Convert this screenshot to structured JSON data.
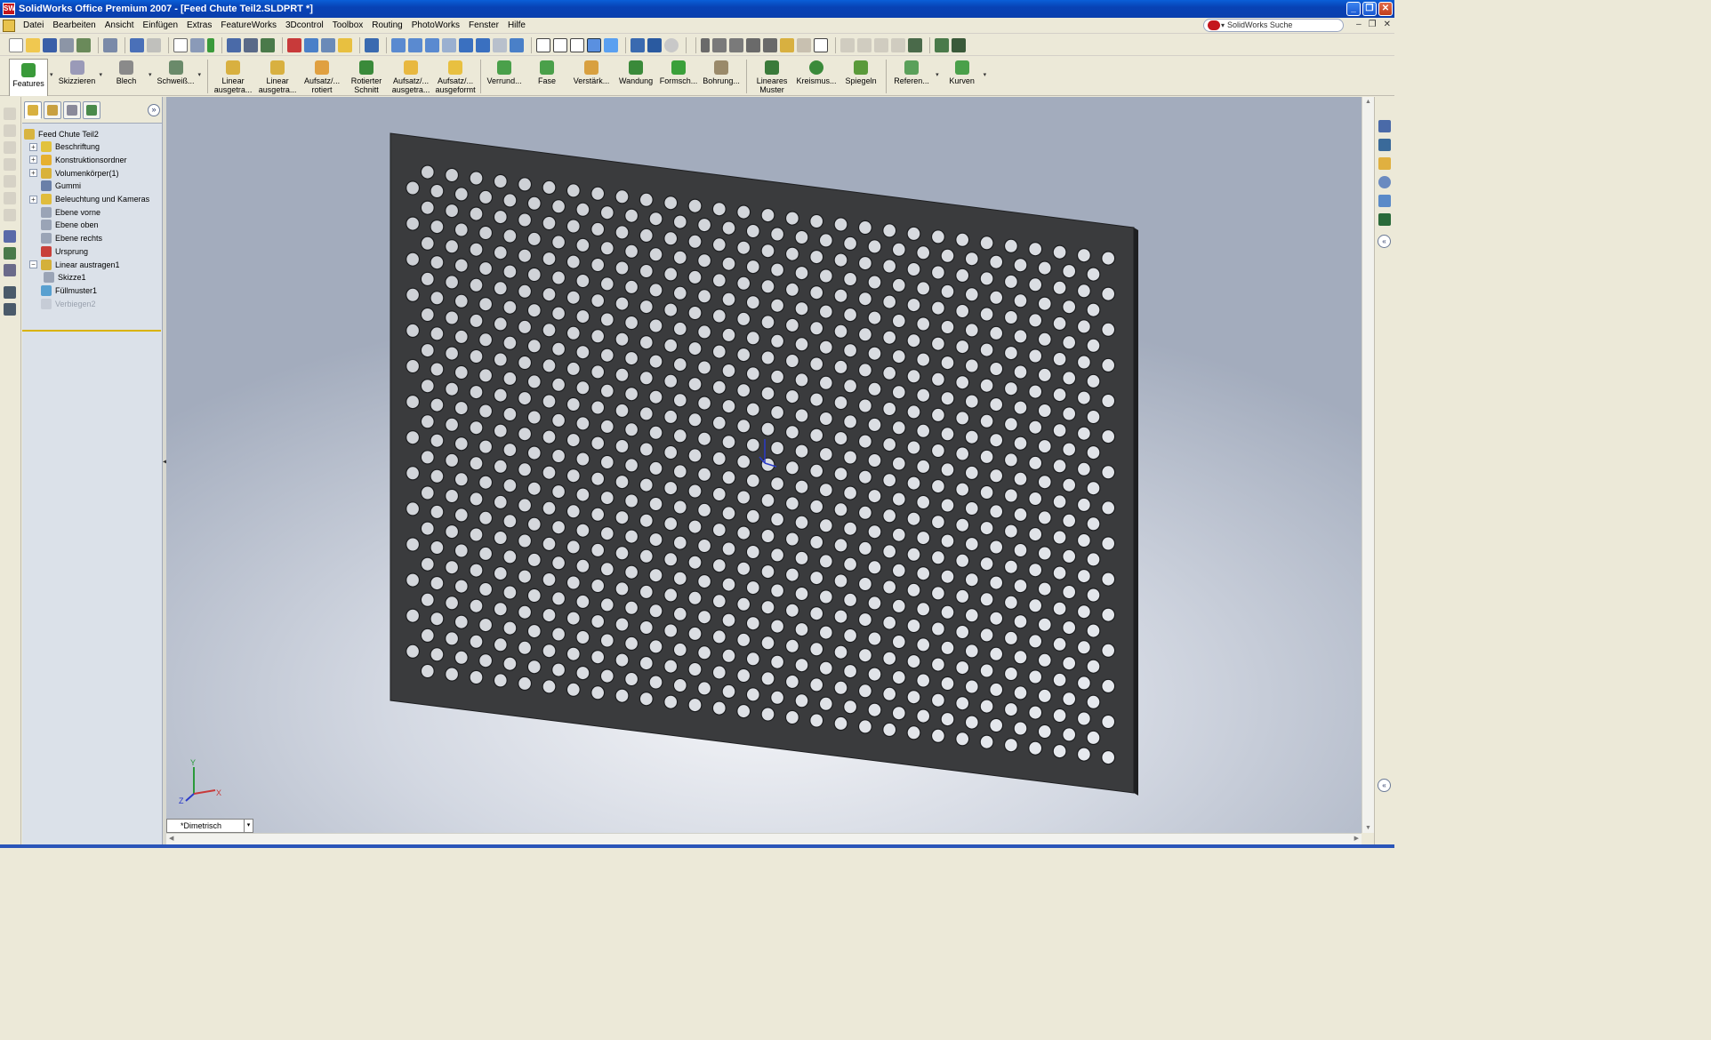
{
  "window": {
    "title": "SolidWorks Office Premium 2007 - [Feed Chute Teil2.SLDPRT *]",
    "app_icon_text": "SW",
    "controls": [
      "_",
      "❐",
      "✕"
    ]
  },
  "menu": {
    "items": [
      "Datei",
      "Bearbeiten",
      "Ansicht",
      "Einfügen",
      "Extras",
      "FeatureWorks",
      "3Dcontrol",
      "Toolbox",
      "Routing",
      "PhotoWorks",
      "Fenster",
      "Hilfe"
    ],
    "search_placeholder": "SolidWorks Suche",
    "search_caret": "▾",
    "doc_controls": [
      "–",
      "❐",
      "✕"
    ]
  },
  "command_manager": {
    "tabs": [
      {
        "line1": "Features",
        "line2": ""
      },
      {
        "line1": "Skizzieren",
        "line2": ""
      },
      {
        "line1": "Blech",
        "line2": ""
      },
      {
        "line1": "Schweiß...",
        "line2": ""
      }
    ],
    "tools": [
      {
        "line1": "Linear",
        "line2": "ausgetra..."
      },
      {
        "line1": "Linear",
        "line2": "ausgetra..."
      },
      {
        "line1": "Aufsatz/...",
        "line2": "rotiert"
      },
      {
        "line1": "Rotierter",
        "line2": "Schnitt"
      },
      {
        "line1": "Aufsatz/...",
        "line2": "ausgetra..."
      },
      {
        "line1": "Aufsatz/...",
        "line2": "ausgeformt"
      },
      {
        "line1": "Verrund...",
        "line2": ""
      },
      {
        "line1": "Fase",
        "line2": ""
      },
      {
        "line1": "Verstärk...",
        "line2": ""
      },
      {
        "line1": "Wandung",
        "line2": ""
      },
      {
        "line1": "Formsch...",
        "line2": ""
      },
      {
        "line1": "Bohrung...",
        "line2": ""
      },
      {
        "line1": "Lineares",
        "line2": "Muster"
      },
      {
        "line1": "Kreismus...",
        "line2": ""
      },
      {
        "line1": "Spiegeln",
        "line2": ""
      },
      {
        "line1": "Referen...",
        "line2": ""
      },
      {
        "line1": "Kurven",
        "line2": ""
      }
    ]
  },
  "feature_tree": {
    "expand_glyph": "»",
    "items": [
      {
        "label": "Feed Chute Teil2",
        "toggle": "",
        "icon_color": "#d8b440",
        "dim": false
      },
      {
        "label": "Beschriftung",
        "toggle": "+",
        "icon_color": "#e2c23c",
        "dim": false
      },
      {
        "label": "Konstruktionsordner",
        "toggle": "+",
        "icon_color": "#e6b030",
        "dim": false
      },
      {
        "label": "Volumenkörper(1)",
        "toggle": "+",
        "icon_color": "#d9b23a",
        "dim": false
      },
      {
        "label": "Gummi",
        "toggle": "",
        "icon_color": "#6a7fa8",
        "dim": false
      },
      {
        "label": "Beleuchtung und Kameras",
        "toggle": "+",
        "icon_color": "#e0bc3c",
        "dim": false
      },
      {
        "label": "Ebene vorne",
        "toggle": "",
        "icon_color": "#9aa4b6",
        "dim": false
      },
      {
        "label": "Ebene oben",
        "toggle": "",
        "icon_color": "#9aa4b6",
        "dim": false
      },
      {
        "label": "Ebene rechts",
        "toggle": "",
        "icon_color": "#9aa4b6",
        "dim": false
      },
      {
        "label": "Ursprung",
        "toggle": "",
        "icon_color": "#c8403a",
        "dim": false
      },
      {
        "label": "Linear austragen1",
        "toggle": "−",
        "icon_color": "#d4b03a",
        "dim": false
      },
      {
        "label": "Skizze1",
        "toggle": "",
        "icon_color": "#9aa4b6",
        "dim": false
      },
      {
        "label": "Füllmuster1",
        "toggle": "",
        "icon_color": "#58a0d0",
        "dim": false
      },
      {
        "label": "Verbiegen2",
        "toggle": "",
        "icon_color": "#c6ccd6",
        "dim": true
      }
    ]
  },
  "viewport": {
    "view_orientation": "*Dimetrisch",
    "dropdown_glyph": "▾",
    "collapse_glyph": "◀",
    "part": {
      "plate_color": "#3a3b3d",
      "edge_color": "#1e1f21",
      "hole_rows": 29,
      "holes_per_row": [
        30,
        29
      ]
    },
    "triad": {
      "x": "X",
      "y": "Y",
      "z": "Z"
    }
  },
  "task_pane": {
    "collapse_glyph": "«"
  }
}
